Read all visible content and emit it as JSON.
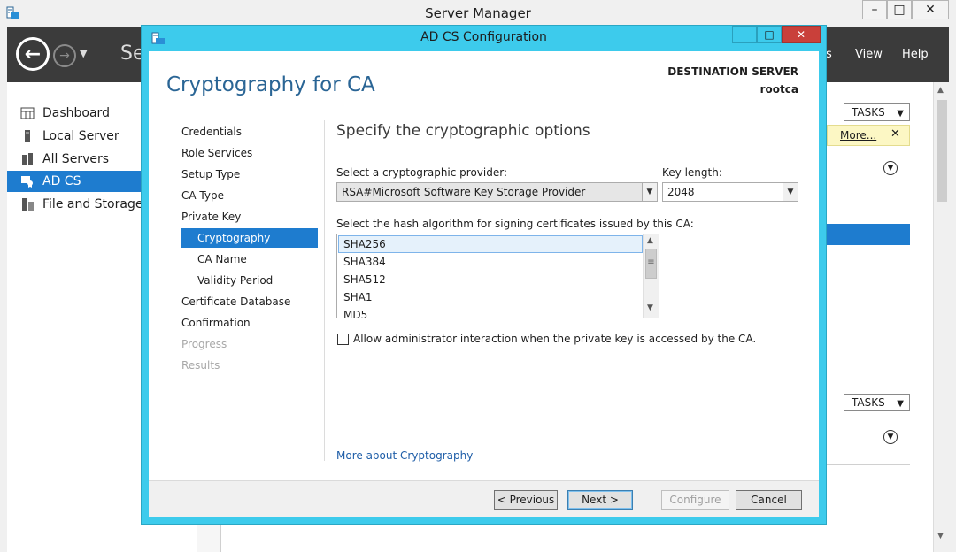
{
  "server_manager": {
    "title": "Server Manager",
    "breadcrumb_visible": "Se",
    "menus": [
      "s",
      "View",
      "Help"
    ],
    "sidebar": [
      {
        "label": "Dashboard",
        "icon": "dashboard-icon"
      },
      {
        "label": "Local Server",
        "icon": "server-icon"
      },
      {
        "label": "All Servers",
        "icon": "servers-icon"
      },
      {
        "label": "AD CS",
        "icon": "certificate-icon"
      },
      {
        "label": "File and Storage S",
        "icon": "storage-icon"
      }
    ],
    "active_sidebar_index": 3,
    "tasks_label": "TASKS",
    "notification_link": "More...",
    "notification_close": "✕"
  },
  "dialog": {
    "title": "AD CS Configuration",
    "page_heading": "Cryptography for CA",
    "destination_label": "DESTINATION SERVER",
    "destination_value": "rootca",
    "steps": [
      {
        "label": "Credentials",
        "state": "normal",
        "sub": false
      },
      {
        "label": "Role Services",
        "state": "normal",
        "sub": false
      },
      {
        "label": "Setup Type",
        "state": "normal",
        "sub": false
      },
      {
        "label": "CA Type",
        "state": "normal",
        "sub": false
      },
      {
        "label": "Private Key",
        "state": "normal",
        "sub": false
      },
      {
        "label": "Cryptography",
        "state": "active",
        "sub": true
      },
      {
        "label": "CA Name",
        "state": "normal",
        "sub": true
      },
      {
        "label": "Validity Period",
        "state": "normal",
        "sub": true
      },
      {
        "label": "Certificate Database",
        "state": "normal",
        "sub": false
      },
      {
        "label": "Confirmation",
        "state": "normal",
        "sub": false
      },
      {
        "label": "Progress",
        "state": "disabled",
        "sub": false
      },
      {
        "label": "Results",
        "state": "disabled",
        "sub": false
      }
    ],
    "content": {
      "heading": "Specify the cryptographic options",
      "provider_label": "Select a cryptographic provider:",
      "provider_value": "RSA#Microsoft Software Key Storage Provider",
      "key_length_label": "Key length:",
      "key_length_value": "2048",
      "hash_label": "Select the hash algorithm for signing certificates issued by this CA:",
      "hash_options": [
        "SHA256",
        "SHA384",
        "SHA512",
        "SHA1",
        "MD5"
      ],
      "hash_selected": "SHA256",
      "admin_interaction_label": "Allow administrator interaction when the private key is accessed by the CA.",
      "admin_interaction_checked": false,
      "more_link": "More about Cryptography"
    },
    "buttons": {
      "previous": "< Previous",
      "next": "Next >",
      "configure": "Configure",
      "cancel": "Cancel"
    }
  },
  "colors": {
    "dialog_frame": "#3dcbec",
    "selection_blue": "#1e7ccf",
    "heading_blue": "#2a6595",
    "nav_dark": "#3b3b3b",
    "close_red": "#c9403a"
  }
}
